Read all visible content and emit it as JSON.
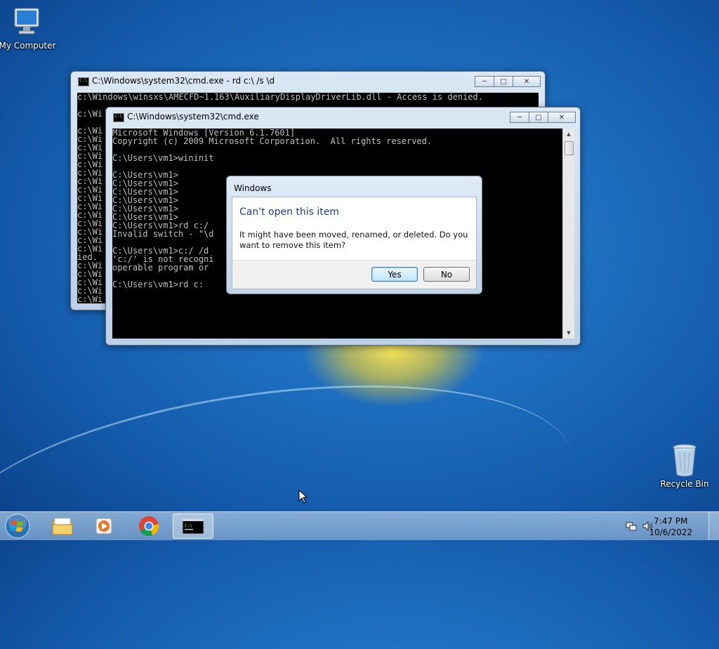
{
  "desktop": {
    "icons": [
      {
        "label": "My Computer",
        "icon": "computer-icon"
      },
      {
        "label": "Recycle Bin",
        "icon": "recycle-bin-icon"
      }
    ]
  },
  "cmd_back": {
    "title": "C:\\Windows\\system32\\cmd.exe - rd  c:\\ /s \\d",
    "lines": [
      "c:\\Windows\\winsxs\\AMECFD~1.163\\AuxiliaryDisplayDriverLib.dll - Access is denied.",
      "",
      "c:\\Wi",
      "",
      "c:\\Wi",
      "c:\\Wi",
      "c:\\Wi",
      "c:\\Wi",
      "c:\\Wi",
      "c:\\Wi",
      "c:\\Wi",
      "c:\\Wi",
      "c:\\Wi",
      "c:\\Wi",
      "c:\\Wi",
      "c:\\Wi",
      "c:\\Wi",
      "c:\\Wi",
      "c:\\Wi",
      "ied.",
      "c:\\Wi",
      "c:\\Wi",
      "c:\\Wi",
      "c:\\Wi",
      "c:\\Wi",
      "c:\\Wi",
      "c:\\Wi",
      "c:\\Wi"
    ]
  },
  "cmd_front": {
    "title": "C:\\Windows\\system32\\cmd.exe",
    "lines": [
      "Microsoft Windows [Version 6.1.7601]",
      "Copyright (c) 2009 Microsoft Corporation.  All rights reserved.",
      "",
      "C:\\Users\\vm1>wininit",
      "",
      "C:\\Users\\vm1>",
      "C:\\Users\\vm1>",
      "C:\\Users\\vm1>",
      "C:\\Users\\vm1>",
      "C:\\Users\\vm1>",
      "C:\\Users\\vm1>",
      "C:\\Users\\vm1>rd c:/ ",
      "Invalid switch - \"\\d",
      "",
      "C:\\Users\\vm1>c:/ /d",
      "'c:/' is not recogni",
      "operable program or ",
      "",
      "C:\\Users\\vm1>rd c:"
    ]
  },
  "dialog": {
    "title": "Windows",
    "heading": "Can't open this item",
    "message": "It might have been moved, renamed, or deleted. Do you want to remove this item?",
    "yes_label": "Yes",
    "no_label": "No"
  },
  "taskbar": {
    "items": [
      "start-orb",
      "explorer",
      "media-player",
      "chrome",
      "cmd"
    ],
    "time": "7:47 PM",
    "date": "10/6/2022"
  }
}
